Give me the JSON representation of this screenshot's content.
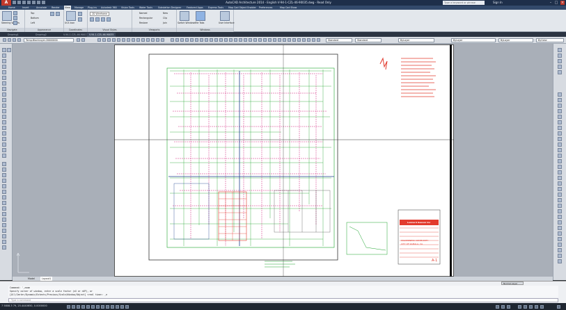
{
  "window": {
    "app_logo": "A",
    "title": "AutoCAD Architecture 2014 - English   V-94-1-CZL-46-90035.dwg - Read Only",
    "search_placeholder": "Type a keyword or phrase",
    "sign_in": "Sign In",
    "minimize": "–",
    "maximize": "□",
    "close": "×"
  },
  "ribbon_tabs": [
    "Home",
    "Insert",
    "Annotate",
    "Render",
    "View",
    "Manage",
    "Plug-ins",
    "Autodesk 360",
    "Vision Tools",
    "Water Tools",
    "Substation Designer",
    "Featured Apps",
    "Express Tools",
    "Map Cad Object Enabler",
    "Preferences",
    "Map Cad Show"
  ],
  "active_tab": "View",
  "ribbon": {
    "navigate": {
      "title": "Navigate",
      "steering_wheels": "Steering Wheels",
      "top": "Top",
      "bottom": "Bottom",
      "left": "Left"
    },
    "appearance": {
      "title": "Appearance"
    },
    "coordinates": {
      "title": "Coordinates",
      "ucs_icon": "UCS Icon"
    },
    "visual_styles": {
      "title": "Visual Styles",
      "style_name": "2D Wireframe"
    },
    "viewports": {
      "title": "Viewports",
      "named": "Named",
      "rectangular": "Rectangular",
      "new": "New",
      "clip": "Clip",
      "join": "Join",
      "restore": "Restore"
    },
    "windows": {
      "title": "Windows",
      "switch_windows": "Switch Windows",
      "file_tabs": "File Tabs",
      "user_interface": "User Interface"
    }
  },
  "file_tabs": [
    "Drawing1",
    "Drawing2",
    "V-94-1-CZL-46-90017",
    "V-94-1-CZL-46-90035"
  ],
  "active_file_tab": "V-94-1-CZL-46-90035",
  "toolbar": {
    "layer_select": "Temp-BlockLayer-20000000",
    "linetype_select": "Standard",
    "dimstyle_select": "Standard",
    "color_select": "ByLayer",
    "lineweight_select": "ByLayer",
    "plotstyle_select": "ByColor"
  },
  "drawing": {
    "title_block": {
      "company": "Lennard Gasson Inc",
      "project": "WILDERNESS COMMUNITY",
      "location": "CITY OF KAMALA, CA",
      "sheet": "A-1"
    }
  },
  "layout_tabs": [
    "Model",
    "Layout1"
  ],
  "active_layout": "Layout1",
  "command_history": [
    "Command: '_zoom",
    "Specify corner of window, enter a scale factor (nX or nXP), or",
    "[All/Center/Dynamic/Extents/Previous/Scale/Window/Object] <real time>: _e"
  ],
  "command_prompt": "Type a command",
  "annotation_scale": "Normal Layer",
  "status": {
    "coordinates": "7 5808.3 79, 25.4440650, 0.0000000"
  },
  "colors": {
    "accent": "#e23b2e",
    "plan_green": "#1aa32a",
    "plan_magenta": "#d0247f"
  }
}
